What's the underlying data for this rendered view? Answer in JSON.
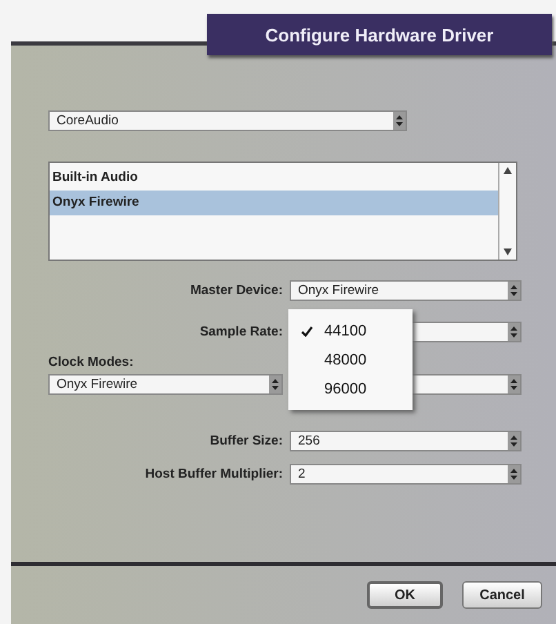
{
  "window": {
    "title": "Configure Hardware Driver"
  },
  "driver_popup": {
    "value": "CoreAudio"
  },
  "device_list": [
    {
      "label": "Built-in Audio",
      "selected": false
    },
    {
      "label": "Onyx Firewire",
      "selected": true
    }
  ],
  "master_device": {
    "label": "Master Device:",
    "value": "Onyx Firewire"
  },
  "sample_rate": {
    "label": "Sample Rate:",
    "menu": [
      {
        "label": "44100",
        "checked": true
      },
      {
        "label": "48000",
        "checked": false
      },
      {
        "label": "96000",
        "checked": false
      }
    ]
  },
  "clock_modes": {
    "label": "Clock Modes:",
    "value": "Onyx Firewire"
  },
  "buffer_size": {
    "label": "Buffer Size:",
    "value": "256"
  },
  "host_buffer_multiplier": {
    "label": "Host Buffer Multiplier:",
    "value": "2"
  },
  "buttons": [
    {
      "label": "OK",
      "kind": "default"
    },
    {
      "label": "Cancel",
      "kind": "normal"
    }
  ]
}
